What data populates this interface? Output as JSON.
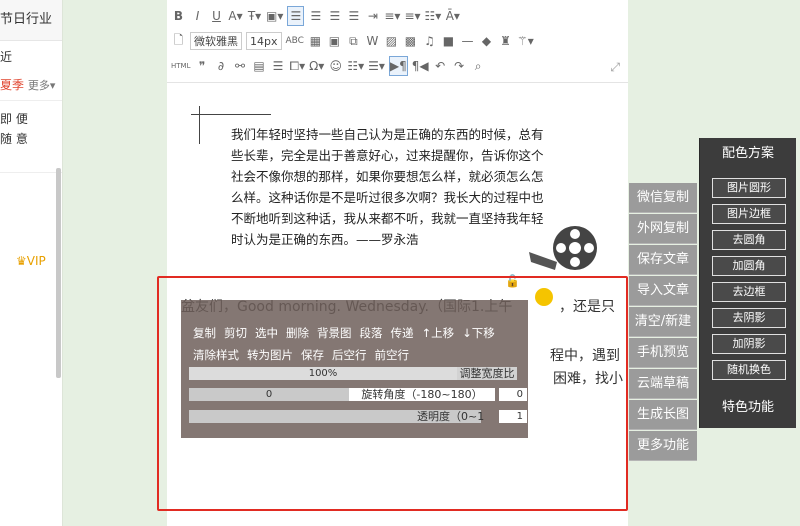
{
  "left_panel": {
    "title": "节日行业",
    "row1": "近",
    "hot": "夏季",
    "more": "更多▾",
    "row_a": "即 便",
    "row_b": "随 意",
    "vip": "VIP"
  },
  "toolbar": {
    "font_family": "微软雅黑",
    "font_size": "14px"
  },
  "content": {
    "paragraph_lines": [
      "我们年轻时坚持一些自己认为是正确的东西的时候，总有",
      "些长辈，完全是出于善意好心，过来提醒你，告诉你这个",
      "社会不像你想的那样，如果你要想怎么样，就必须怎么怎",
      "么样。这种话你是不是听过很多次啊？我长大的过程中也",
      "不断地听到这种话，我从来都不听，我就一直坚持我年轻",
      "时认为是正确的东西。——罗永浩"
    ],
    "line2": "盆友们，Good morning. Wednesday.（国际1.上午",
    "line2b": "，还是只",
    "line3b": "程中，遇到",
    "line4b": "困难，找小"
  },
  "float_panel": {
    "actions_row1": [
      "复制",
      "剪切",
      "选中",
      "删除",
      "背景图",
      "段落",
      "传递",
      "↑上移",
      "↓下移"
    ],
    "actions_row2": [
      "清除样式",
      "转为图片",
      "保存",
      "后空行",
      "前空行"
    ],
    "width_value": "100%",
    "width_label": "调整宽度比",
    "rotate_value": "0",
    "rotate_label": "旋转角度（-180~180）",
    "rotate_num": "0",
    "opacity_label": "透明度（0~1",
    "opacity_num": "1"
  },
  "right_buttons": [
    "微信复制",
    "外网复制",
    "保存文章",
    "导入文章",
    "清空/新建",
    "手机预览",
    "云端草稿",
    "生成长图",
    "更多功能"
  ],
  "palette": {
    "title": "配色方案",
    "buttons": [
      "图片圆形",
      "图片边框",
      "去圆角",
      "加圆角",
      "去边框",
      "去阴影",
      "加阴影",
      "随机换色"
    ],
    "bottom": "特色功能"
  }
}
